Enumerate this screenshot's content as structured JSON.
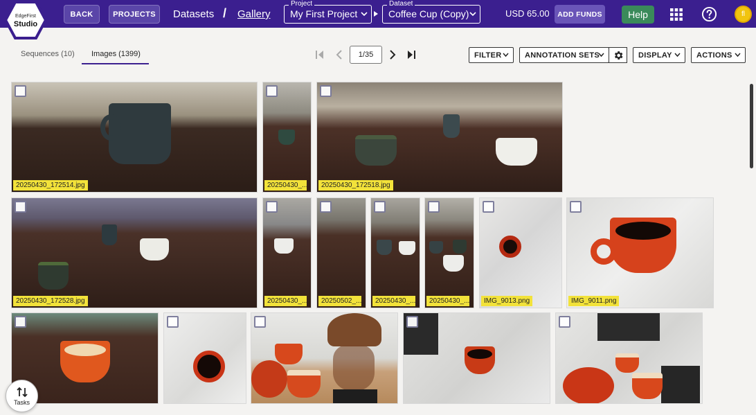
{
  "header": {
    "logo_line1": "EdgeFirst",
    "logo_line2": "Studio",
    "back_label": "BACK",
    "projects_label": "PROJECTS",
    "breadcrumb_datasets": "Datasets",
    "breadcrumb_separator": "/",
    "breadcrumb_gallery": "Gallery",
    "project_label": "Project",
    "project_value": "My First Project",
    "dataset_label": "Dataset",
    "dataset_value": "Coffee Cup (Copy)",
    "balance": "USD 65.00",
    "add_funds_label": "ADD FUNDS",
    "help_label": "Help",
    "avatar_initial": "fl",
    "brand_color": "#3b1f8f"
  },
  "toolbar": {
    "tabs": [
      {
        "label": "Sequences (10)"
      },
      {
        "label": "Images (1399)"
      }
    ],
    "page": "1/35",
    "filter_label": "FILTER",
    "annotation_sets_label": "ANNOTATION SETS",
    "display_label": "DISPLAY",
    "actions_label": "ACTIONS"
  },
  "gallery": {
    "tiles": [
      {
        "caption": "20250430_172514.jpg",
        "scene": "dark-mug-table"
      },
      {
        "caption": "20250430_...",
        "scene": "small-mug-office"
      },
      {
        "caption": "20250430_172518.jpg",
        "scene": "two-mugs-lab"
      },
      {
        "caption": "20250430_172528.jpg",
        "scene": "three-mugs-table"
      },
      {
        "caption": "20250430_...",
        "scene": "white-mug-office"
      },
      {
        "caption": "20250502_...",
        "scene": "table-empty"
      },
      {
        "caption": "20250430_...",
        "scene": "two-mugs-small"
      },
      {
        "caption": "20250430_...",
        "scene": "three-mugs-small"
      },
      {
        "caption": "IMG_9013.png",
        "scene": "red-cup-marble"
      },
      {
        "caption": "IMG_9011.png",
        "scene": "red-cup-coffee"
      },
      {
        "caption": "",
        "scene": "orange-cup-table"
      },
      {
        "caption": "",
        "scene": "red-cup-topdown"
      },
      {
        "caption": "",
        "scene": "chemex-cups"
      },
      {
        "caption": "",
        "scene": "red-cup-coffee-small"
      },
      {
        "caption": "",
        "scene": "red-cups-plate"
      }
    ]
  },
  "tasks_label": "Tasks"
}
